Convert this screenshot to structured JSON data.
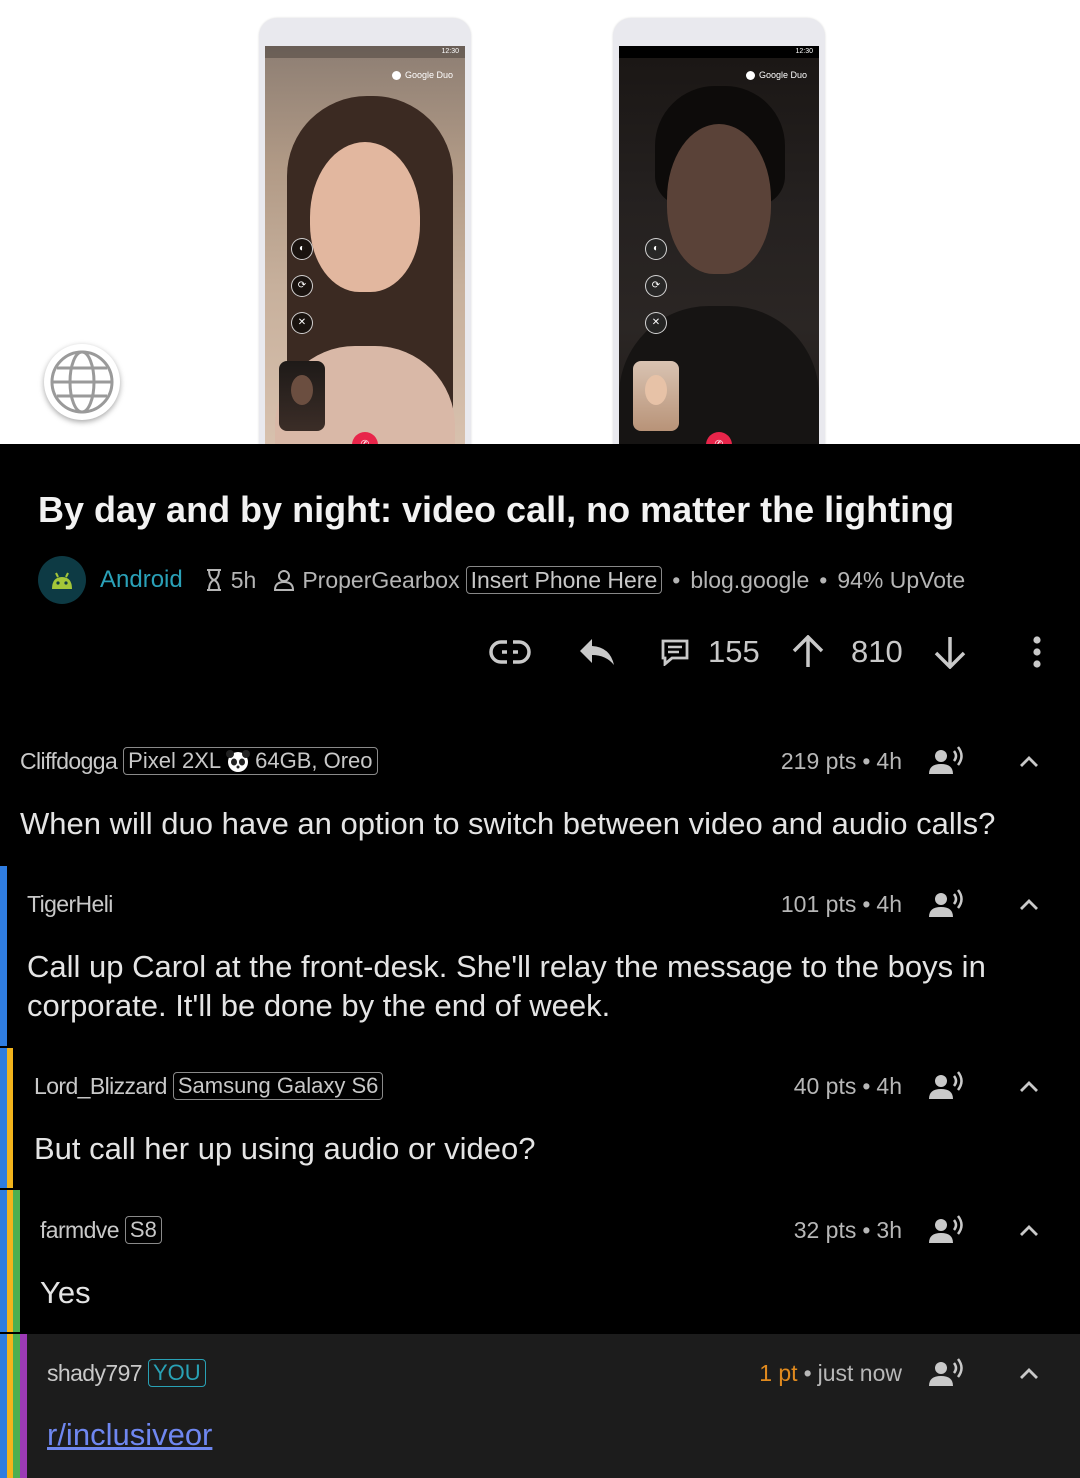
{
  "hero": {
    "phone_day": {
      "app_label": "Google Duo",
      "status_time": "12:30"
    },
    "phone_night": {
      "app_label": "Google Duo",
      "status_time": "12:30"
    }
  },
  "post": {
    "title": "By day and by night: video call, no matter the lighting",
    "subreddit": "Android",
    "age": "5h",
    "author": "ProperGearbox",
    "author_flair": "Insert Phone Here",
    "domain": "blog.google",
    "upvote_ratio": "94% UpVote",
    "comment_count": "155",
    "score": "810"
  },
  "comments": [
    {
      "author": "Cliffdogga",
      "flair_pre": "Pixel 2XL",
      "flair_post": "64GB, Oreo",
      "points": "219 pts",
      "age": "4h",
      "body": "When will duo have an option to switch between video and audio calls?"
    },
    {
      "author": "TigerHeli",
      "points": "101 pts",
      "age": "4h",
      "body": "Call up Carol at the front-desk. She'll relay the message to the boys in corporate. It'll be done by the end of week."
    },
    {
      "author": "Lord_Blizzard",
      "flair": "Samsung Galaxy S6",
      "points": "40 pts",
      "age": "4h",
      "body": "But call her up using audio or video?"
    },
    {
      "author": "farmdve",
      "flair": "S8",
      "points": "32 pts",
      "age": "3h",
      "body": "Yes"
    },
    {
      "author": "shady797",
      "flair": "YOU",
      "points": "1 pt",
      "age": "just now",
      "body": "r/inclusiveor"
    }
  ],
  "separator": "•",
  "colors": {
    "background": "#000000",
    "subreddit": "#2aa1b8",
    "link": "#6f87f0",
    "own_points": "#e08a1e",
    "depth_bars": [
      "#2f7de1",
      "#f2b41c",
      "#4caf50",
      "#9c3bb5"
    ],
    "highlight_bg": "#1c1c1c"
  },
  "icons": [
    "globe-icon",
    "subreddit-icon",
    "hourglass-icon",
    "user-icon",
    "link-icon",
    "reply-icon",
    "comments-icon",
    "upvote-icon",
    "downvote-icon",
    "more-icon",
    "speak-icon",
    "collapse-icon"
  ]
}
